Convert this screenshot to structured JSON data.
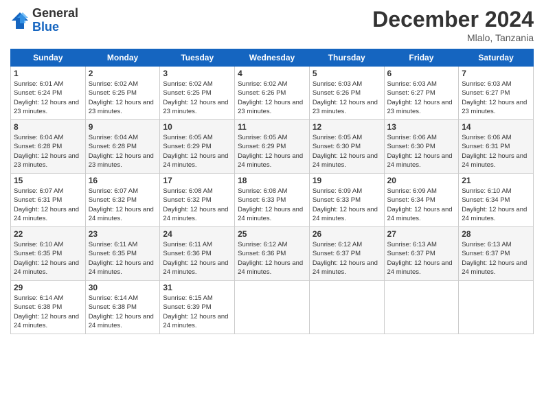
{
  "logo": {
    "general": "General",
    "blue": "Blue"
  },
  "title": "December 2024",
  "location": "Mlalo, Tanzania",
  "days_header": [
    "Sunday",
    "Monday",
    "Tuesday",
    "Wednesday",
    "Thursday",
    "Friday",
    "Saturday"
  ],
  "weeks": [
    [
      {
        "day": "1",
        "sunrise": "6:01 AM",
        "sunset": "6:24 PM",
        "daylight": "12 hours and 23 minutes."
      },
      {
        "day": "2",
        "sunrise": "6:02 AM",
        "sunset": "6:25 PM",
        "daylight": "12 hours and 23 minutes."
      },
      {
        "day": "3",
        "sunrise": "6:02 AM",
        "sunset": "6:25 PM",
        "daylight": "12 hours and 23 minutes."
      },
      {
        "day": "4",
        "sunrise": "6:02 AM",
        "sunset": "6:26 PM",
        "daylight": "12 hours and 23 minutes."
      },
      {
        "day": "5",
        "sunrise": "6:03 AM",
        "sunset": "6:26 PM",
        "daylight": "12 hours and 23 minutes."
      },
      {
        "day": "6",
        "sunrise": "6:03 AM",
        "sunset": "6:27 PM",
        "daylight": "12 hours and 23 minutes."
      },
      {
        "day": "7",
        "sunrise": "6:03 AM",
        "sunset": "6:27 PM",
        "daylight": "12 hours and 23 minutes."
      }
    ],
    [
      {
        "day": "8",
        "sunrise": "6:04 AM",
        "sunset": "6:28 PM",
        "daylight": "12 hours and 23 minutes."
      },
      {
        "day": "9",
        "sunrise": "6:04 AM",
        "sunset": "6:28 PM",
        "daylight": "12 hours and 23 minutes."
      },
      {
        "day": "10",
        "sunrise": "6:05 AM",
        "sunset": "6:29 PM",
        "daylight": "12 hours and 24 minutes."
      },
      {
        "day": "11",
        "sunrise": "6:05 AM",
        "sunset": "6:29 PM",
        "daylight": "12 hours and 24 minutes."
      },
      {
        "day": "12",
        "sunrise": "6:05 AM",
        "sunset": "6:30 PM",
        "daylight": "12 hours and 24 minutes."
      },
      {
        "day": "13",
        "sunrise": "6:06 AM",
        "sunset": "6:30 PM",
        "daylight": "12 hours and 24 minutes."
      },
      {
        "day": "14",
        "sunrise": "6:06 AM",
        "sunset": "6:31 PM",
        "daylight": "12 hours and 24 minutes."
      }
    ],
    [
      {
        "day": "15",
        "sunrise": "6:07 AM",
        "sunset": "6:31 PM",
        "daylight": "12 hours and 24 minutes."
      },
      {
        "day": "16",
        "sunrise": "6:07 AM",
        "sunset": "6:32 PM",
        "daylight": "12 hours and 24 minutes."
      },
      {
        "day": "17",
        "sunrise": "6:08 AM",
        "sunset": "6:32 PM",
        "daylight": "12 hours and 24 minutes."
      },
      {
        "day": "18",
        "sunrise": "6:08 AM",
        "sunset": "6:33 PM",
        "daylight": "12 hours and 24 minutes."
      },
      {
        "day": "19",
        "sunrise": "6:09 AM",
        "sunset": "6:33 PM",
        "daylight": "12 hours and 24 minutes."
      },
      {
        "day": "20",
        "sunrise": "6:09 AM",
        "sunset": "6:34 PM",
        "daylight": "12 hours and 24 minutes."
      },
      {
        "day": "21",
        "sunrise": "6:10 AM",
        "sunset": "6:34 PM",
        "daylight": "12 hours and 24 minutes."
      }
    ],
    [
      {
        "day": "22",
        "sunrise": "6:10 AM",
        "sunset": "6:35 PM",
        "daylight": "12 hours and 24 minutes."
      },
      {
        "day": "23",
        "sunrise": "6:11 AM",
        "sunset": "6:35 PM",
        "daylight": "12 hours and 24 minutes."
      },
      {
        "day": "24",
        "sunrise": "6:11 AM",
        "sunset": "6:36 PM",
        "daylight": "12 hours and 24 minutes."
      },
      {
        "day": "25",
        "sunrise": "6:12 AM",
        "sunset": "6:36 PM",
        "daylight": "12 hours and 24 minutes."
      },
      {
        "day": "26",
        "sunrise": "6:12 AM",
        "sunset": "6:37 PM",
        "daylight": "12 hours and 24 minutes."
      },
      {
        "day": "27",
        "sunrise": "6:13 AM",
        "sunset": "6:37 PM",
        "daylight": "12 hours and 24 minutes."
      },
      {
        "day": "28",
        "sunrise": "6:13 AM",
        "sunset": "6:37 PM",
        "daylight": "12 hours and 24 minutes."
      }
    ],
    [
      {
        "day": "29",
        "sunrise": "6:14 AM",
        "sunset": "6:38 PM",
        "daylight": "12 hours and 24 minutes."
      },
      {
        "day": "30",
        "sunrise": "6:14 AM",
        "sunset": "6:38 PM",
        "daylight": "12 hours and 24 minutes."
      },
      {
        "day": "31",
        "sunrise": "6:15 AM",
        "sunset": "6:39 PM",
        "daylight": "12 hours and 24 minutes."
      },
      null,
      null,
      null,
      null
    ]
  ]
}
